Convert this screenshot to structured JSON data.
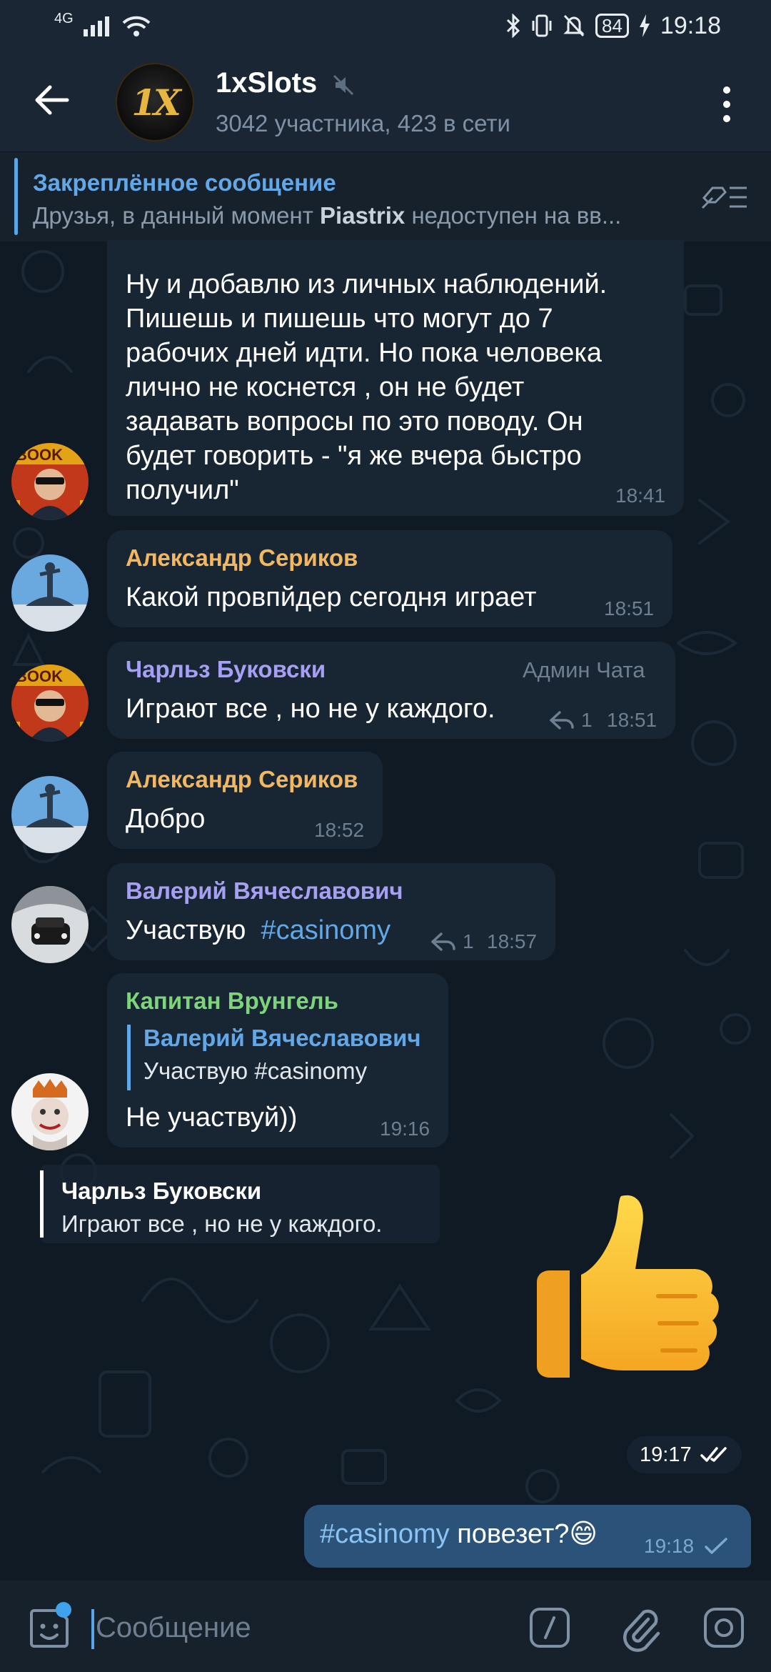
{
  "status_bar": {
    "network": "4G",
    "battery": "84",
    "time": "19:18"
  },
  "header": {
    "avatar_text": "1X",
    "title": "1xSlots",
    "subtitle": "3042 участника, 423 в сети"
  },
  "pinned": {
    "title": "Закреплённое сообщение",
    "text_before": "Друзья, в данный момент ",
    "text_bold": "Piastrix",
    "text_after": " недоступен на вв..."
  },
  "messages": [
    {
      "lines": [
        "Ну и добавлю из личных наблюдений.",
        "Пишешь и пишешь что могут до 7",
        "рабочих дней идти. Но пока человека",
        "лично не коснется , он не будет",
        "задавать вопросы по это поводу. Он",
        "будет говорить - \"я же вчера быстро",
        "получил\""
      ],
      "time": "18:41"
    },
    {
      "sender": "Александр Сериков",
      "text": "Какой провпйдер сегодня играет",
      "time": "18:51"
    },
    {
      "sender": "Чарльз Буковски",
      "admin": "Админ Чата",
      "text": "Играют все , но не у каждого.",
      "replies": "1",
      "time": "18:51"
    },
    {
      "sender": "Александр Сериков",
      "text": "Добро",
      "time": "18:52"
    },
    {
      "sender": "Валерий Вячеславович",
      "text": "Участвую  ",
      "hashtag": "#casinomy",
      "replies": "1",
      "time": "18:57"
    },
    {
      "sender": "Капитан Врунгель",
      "quote_name": "Валерий Вячеславович",
      "quote_text": "Участвую  #casinomy",
      "text": "Не участвуй))",
      "time": "19:16"
    }
  ],
  "reply_preview": {
    "name": "Чарльз Буковски",
    "text": "Играют все , но не у каждого."
  },
  "sticker": {
    "emoji_name": "thumbs-up",
    "time": "19:17"
  },
  "outgoing": {
    "hashtag": "#casinomy",
    "text": " повезет?😄",
    "time": "19:18"
  },
  "input": {
    "placeholder": "Сообщение"
  },
  "colors": {
    "name_orange": "#f2b760",
    "name_purple": "#a69ff3",
    "name_green": "#7ed47b",
    "link_blue": "#62a8e8",
    "bubble_in": "#182533",
    "bubble_out": "#2b5278"
  }
}
